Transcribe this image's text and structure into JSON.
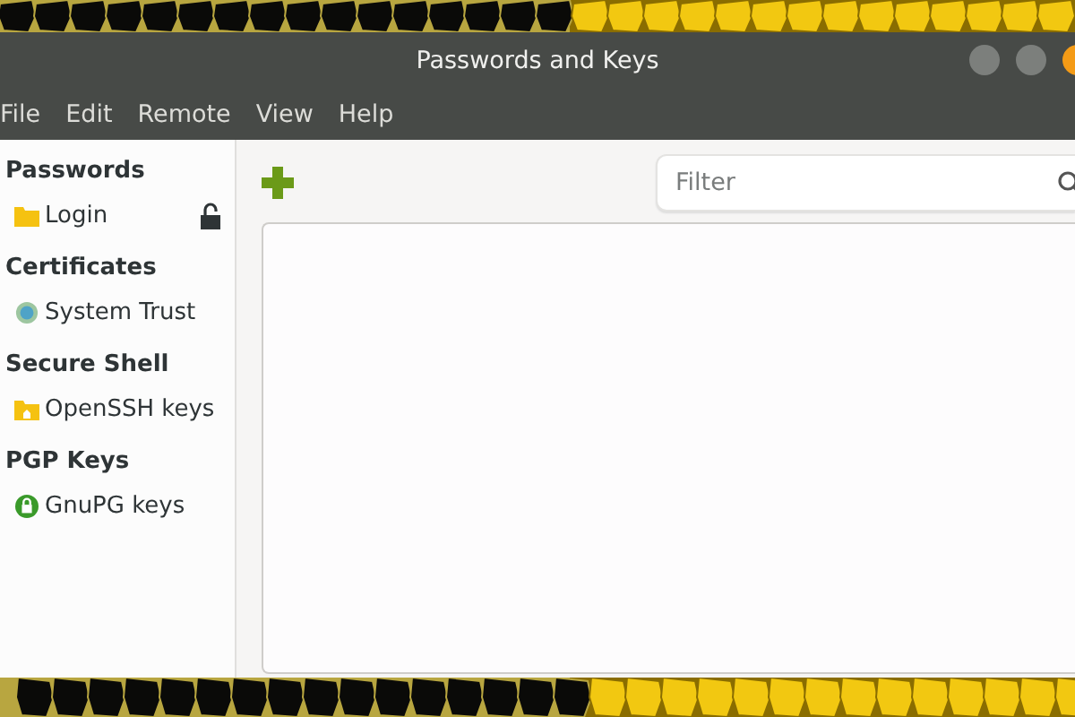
{
  "window": {
    "title": "Passwords and Keys"
  },
  "menu": [
    "File",
    "Edit",
    "Remote",
    "View",
    "Help"
  ],
  "sidebar": [
    {
      "title": "Passwords",
      "items": [
        {
          "label": "Login",
          "locked": false
        }
      ]
    },
    {
      "title": "Certificates",
      "items": [
        {
          "label": "System Trust"
        }
      ]
    },
    {
      "title": "Secure Shell",
      "items": [
        {
          "label": "OpenSSH keys"
        }
      ]
    },
    {
      "title": "PGP Keys",
      "items": [
        {
          "label": "GnuPG keys"
        }
      ]
    }
  ],
  "search": {
    "placeholder": "Filter"
  }
}
